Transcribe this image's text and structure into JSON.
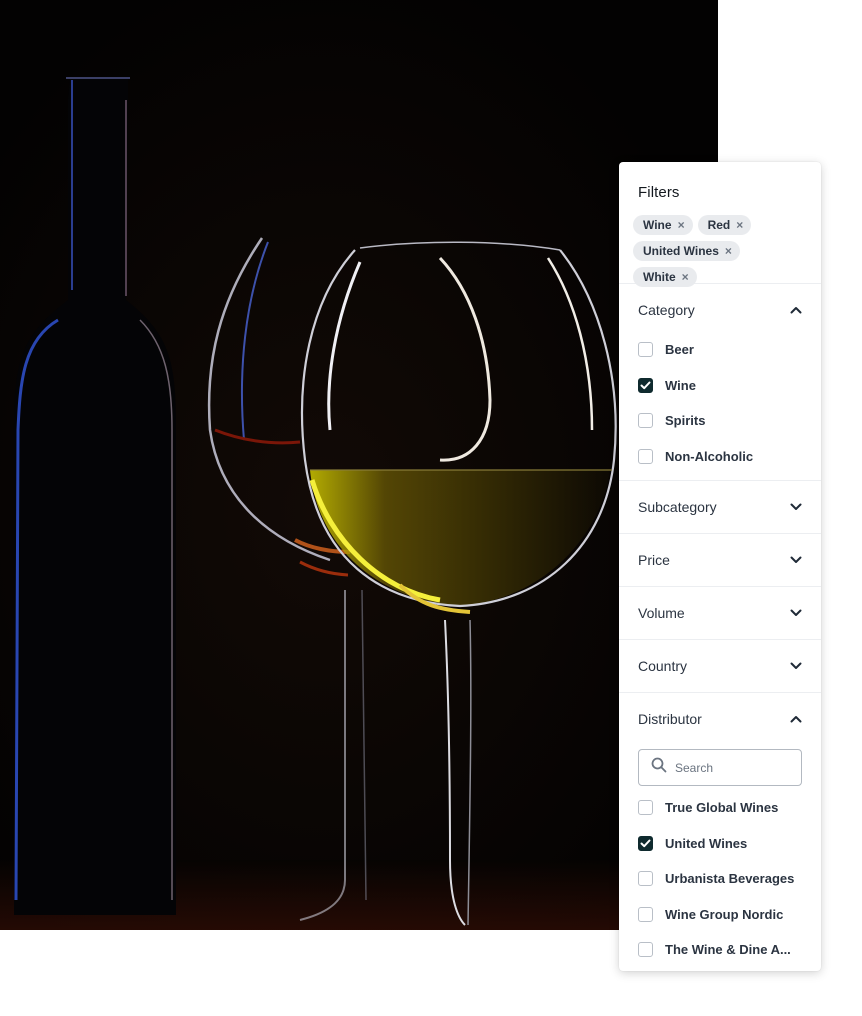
{
  "photo": {
    "subject": "wine-bottle-and-glasses"
  },
  "filters": {
    "title": "Filters",
    "chips": [
      {
        "label": "Wine"
      },
      {
        "label": "Red"
      },
      {
        "label": "United Wines"
      },
      {
        "label": "White"
      }
    ],
    "remove_glyph": "×",
    "sections": {
      "category": {
        "title": "Category",
        "expanded": true,
        "options": [
          {
            "label": "Beer",
            "checked": false
          },
          {
            "label": "Wine",
            "checked": true
          },
          {
            "label": "Spirits",
            "checked": false
          },
          {
            "label": "Non-Alcoholic",
            "checked": false
          }
        ]
      },
      "subcategory": {
        "title": "Subcategory",
        "expanded": false
      },
      "price": {
        "title": "Price",
        "expanded": false
      },
      "volume": {
        "title": "Volume",
        "expanded": false
      },
      "country": {
        "title": "Country",
        "expanded": false
      },
      "distributor": {
        "title": "Distributor",
        "expanded": true,
        "search_placeholder": "Search",
        "options": [
          {
            "label": "True Global Wines",
            "checked": false
          },
          {
            "label": "United Wines",
            "checked": true
          },
          {
            "label": "Urbanista Beverages",
            "checked": false
          },
          {
            "label": "Wine Group Nordic",
            "checked": false
          },
          {
            "label": "The Wine & Dine A...",
            "checked": false
          }
        ]
      }
    }
  },
  "colors": {
    "checkbox_checked": "#0f2a2e",
    "chip_bg": "#e9ebee",
    "photo_bg": "#050302"
  }
}
